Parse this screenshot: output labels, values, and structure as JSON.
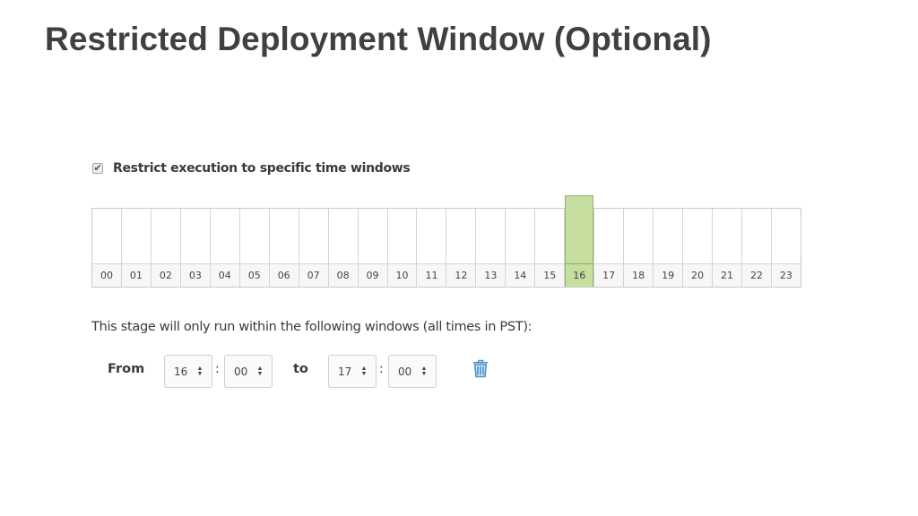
{
  "title": "Restricted Deployment Window (Optional)",
  "restrict": {
    "checked": true,
    "check_glyph": "✔",
    "label": "Restrict execution to specific time windows"
  },
  "hours": {
    "labels": [
      "00",
      "01",
      "02",
      "03",
      "04",
      "05",
      "06",
      "07",
      "08",
      "09",
      "10",
      "11",
      "12",
      "13",
      "14",
      "15",
      "16",
      "17",
      "18",
      "19",
      "20",
      "21",
      "22",
      "23"
    ],
    "selected": [
      "16"
    ],
    "selected_color": "#c6dea0"
  },
  "info_text": "This stage will only run within the following windows (all times in PST):",
  "window": {
    "from_label": "From",
    "from_hour": "16",
    "from_minute": "00",
    "separator": ":",
    "to_label": "to",
    "to_hour": "17",
    "to_minute": "00",
    "delete_icon": "trash-icon",
    "delete_icon_color": "#4a90c8"
  }
}
